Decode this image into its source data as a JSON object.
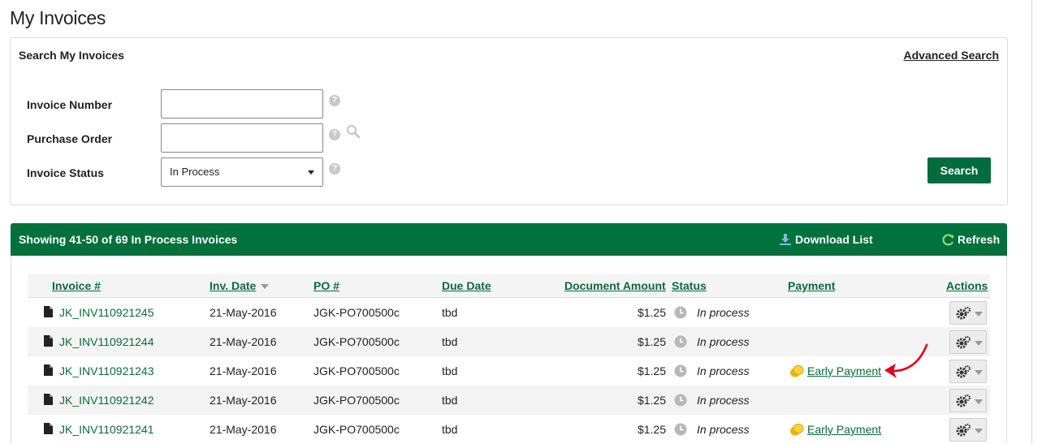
{
  "page": {
    "title": "My Invoices"
  },
  "search": {
    "title": "Search My Invoices",
    "advanced_link": "Advanced Search",
    "invoice_number_label": "Invoice Number",
    "invoice_number_value": "",
    "purchase_order_label": "Purchase Order",
    "purchase_order_value": "",
    "invoice_status_label": "Invoice Status",
    "invoice_status_value": "In Process",
    "help_glyph": "?",
    "search_button": "Search"
  },
  "results": {
    "count_text": "Showing 41-50 of 69 In Process Invoices",
    "download_label": "Download List",
    "refresh_label": "Refresh",
    "columns": {
      "invoice": "Invoice #",
      "inv_date": "Inv. Date",
      "po": "PO #",
      "due_date": "Due Date",
      "amount": "Document Amount",
      "status": "Status",
      "payment": "Payment",
      "actions": "Actions"
    },
    "rows": [
      {
        "invoice": "JK_INV110921245",
        "inv_date": "21-May-2016",
        "po": "JGK-PO700500c",
        "due_date": "tbd",
        "amount": "$1.25",
        "status": "In process",
        "payment": ""
      },
      {
        "invoice": "JK_INV110921244",
        "inv_date": "21-May-2016",
        "po": "JGK-PO700500c",
        "due_date": "tbd",
        "amount": "$1.25",
        "status": "In process",
        "payment": ""
      },
      {
        "invoice": "JK_INV110921243",
        "inv_date": "21-May-2016",
        "po": "JGK-PO700500c",
        "due_date": "tbd",
        "amount": "$1.25",
        "status": "In process",
        "payment": "Early Payment"
      },
      {
        "invoice": "JK_INV110921242",
        "inv_date": "21-May-2016",
        "po": "JGK-PO700500c",
        "due_date": "tbd",
        "amount": "$1.25",
        "status": "In process",
        "payment": ""
      },
      {
        "invoice": "JK_INV110921241",
        "inv_date": "21-May-2016",
        "po": "JGK-PO700500c",
        "due_date": "tbd",
        "amount": "$1.25",
        "status": "In process",
        "payment": "Early Payment"
      }
    ]
  },
  "colors": {
    "brand_green": "#00703c",
    "link_green": "#0b6b3a",
    "annotation_red": "#e3001b"
  },
  "icons": [
    "help-icon",
    "magnifier-icon",
    "download-icon",
    "refresh-icon",
    "document-icon",
    "clock-icon",
    "coin-icon",
    "gear-icon",
    "caret-down-icon",
    "red-arrow-annotation"
  ]
}
